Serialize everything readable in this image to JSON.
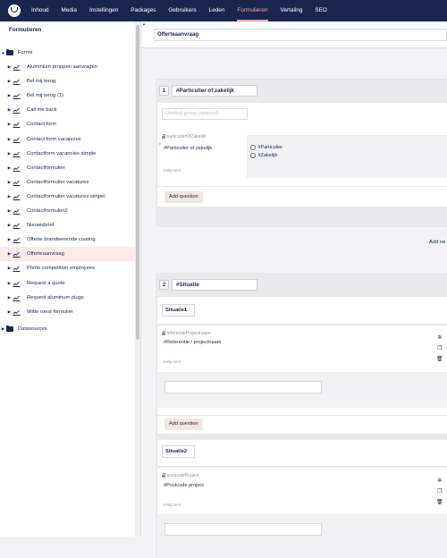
{
  "topnav": {
    "items": [
      "Inhoud",
      "Media",
      "Instellingen",
      "Packages",
      "Gebruikers",
      "Leden",
      "Formulieren",
      "Vertaling",
      "SEO"
    ],
    "active": "Formulieren"
  },
  "sidebar": {
    "title": "Formulieren",
    "root_label": "Forms",
    "forms": [
      "Aluminium proppen aanvragen",
      "Bel mij terug",
      "Bel mij terug (1)",
      "Call me back",
      "Contact form",
      "Contact form vacancies",
      "Contactform vacancies simple",
      "Contactformulier",
      "Contactformulier vacatures",
      "Contactformulier vacatures simpel",
      "Contactformulier2",
      "Nieuwsbrief",
      "Offerte brandwerende coating",
      "Offerteaanvraag",
      "Photo competition employees",
      "Request a quote",
      "Request aluminum plugs",
      "Witte roest formulier"
    ],
    "selected": "Offerteaanvraag",
    "datasources_label": "Datasources"
  },
  "main": {
    "form_name": "Offerteaanvraag",
    "add_new_label": "Add ne",
    "group1": {
      "number": "1",
      "name": "#Particulier of zakelijk",
      "untitled_placeholder": "Untitled group (optional)",
      "alias": "particulierOfZakelijk",
      "question": "#Particulier of zakelijk",
      "required_mark": "*",
      "help": "Help text",
      "options": [
        "#Particulier",
        "#Zakelijk"
      ],
      "add_question": "Add question"
    },
    "group2": {
      "number": "2",
      "name": "#Situatie",
      "set1": {
        "name": "Situatie1",
        "alias": "referentieProjectnaam",
        "question": "#Referentie / projectnaam",
        "help": "Help text",
        "add_question": "Add question"
      },
      "set2": {
        "name": "Situatie2",
        "alias": "postcodeProject",
        "question": "#Postcode project",
        "help": "Help text"
      }
    }
  },
  "icons": {
    "settings": "gear-icon",
    "copy": "copy-icon",
    "delete": "trash-icon"
  },
  "colors": {
    "topbar": "#1b264f",
    "active_nav": "#f5a3a3",
    "selected_row": "#fdeaea",
    "button_bg": "#f2e6e0"
  }
}
